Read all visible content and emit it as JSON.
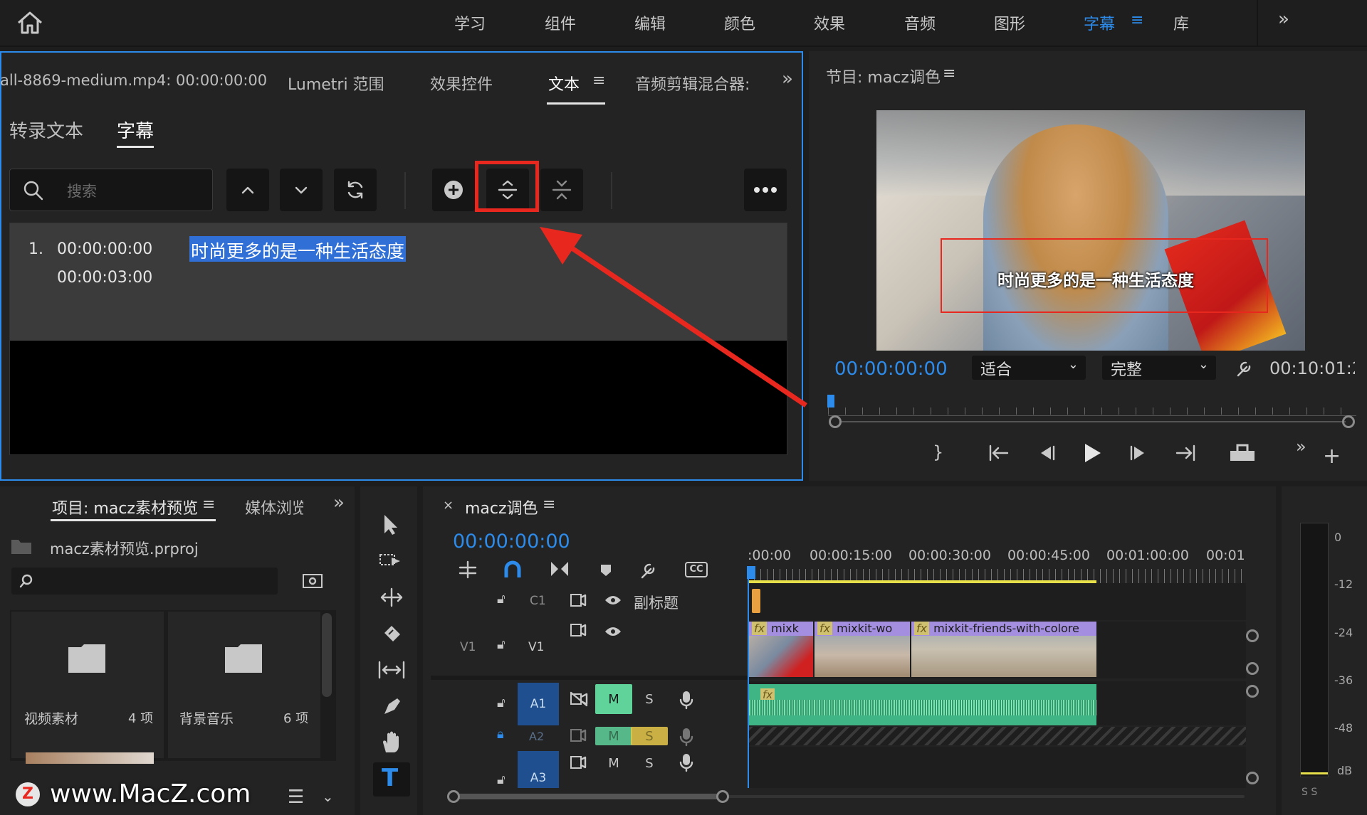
{
  "workspace": {
    "items": [
      "学习",
      "组件",
      "编辑",
      "颜色",
      "效果",
      "音频",
      "图形",
      "字幕",
      "库"
    ],
    "active": "字幕"
  },
  "left_panel": {
    "tabs": [
      "all-8869-medium.mp4: 00:00:00:00",
      "Lumetri 范围",
      "效果控件",
      "文本",
      "音频剪辑混合器:"
    ],
    "active_tab": "文本",
    "subtabs": [
      "转录文本",
      "字幕"
    ],
    "active_subtab": "字幕",
    "search_placeholder": "搜索",
    "captions": [
      {
        "index": "1.",
        "start": "00:00:00:00",
        "end": "00:00:03:00",
        "text": "时尚更多的是一种生活态度"
      }
    ]
  },
  "program_monitor": {
    "title": "节目: macz调色",
    "timecode": "00:00:00:00",
    "fit": "适合",
    "quality": "完整",
    "duration": "00:10:01:2",
    "overlay_caption": "时尚更多的是一种生活态度"
  },
  "project_panel": {
    "tabs": [
      "项目: macz素材预览",
      "媒体浏览"
    ],
    "file": "macz素材预览.prproj",
    "bins": [
      {
        "name": "视频素材",
        "count": "4 项"
      },
      {
        "name": "背景音乐",
        "count": "6 项"
      }
    ]
  },
  "timeline": {
    "sequence": "macz调色",
    "timecode": "00:00:00:00",
    "ruler": [
      ":00:00",
      "00:00:15:00",
      "00:00:30:00",
      "00:00:45:00",
      "00:01:00:00",
      "00:01:"
    ],
    "tracks": {
      "c1": {
        "label": "C1",
        "name": "副标题"
      },
      "v1": {
        "src": "V1",
        "label": "V1"
      },
      "a1": {
        "label": "A1",
        "m": "M",
        "s": "S"
      },
      "a2": {
        "label": "A2",
        "m": "M",
        "s": "S"
      },
      "a3": {
        "label": "A3",
        "m": "M",
        "s": "S"
      }
    },
    "clips": [
      "mixk",
      "mixkit-wo",
      "mixkit-friends-with-colore"
    ]
  },
  "audio_meter": {
    "scale": [
      "0",
      "-12",
      "-24",
      "-36",
      "-48",
      "dB"
    ],
    "bottom": "S S"
  },
  "watermark": "www.MacZ.com",
  "colors": {
    "accent": "#2d8ceb",
    "highlight_box": "#e8281e",
    "clip_purple": "#a48ee0",
    "audio_green": "#3fb585"
  }
}
